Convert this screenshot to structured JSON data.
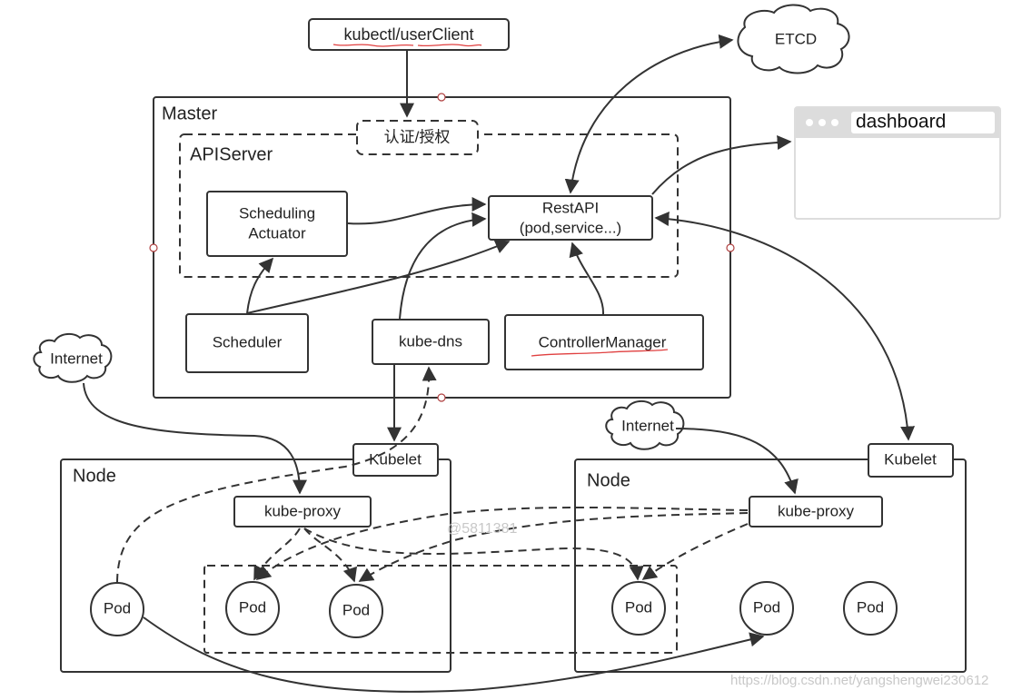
{
  "diagram": {
    "client": {
      "label": "kubectl/userClient"
    },
    "etcd": {
      "label": "ETCD"
    },
    "dashboard": {
      "label": "dashboard"
    },
    "master": {
      "title": "Master",
      "auth": {
        "label": "认证/授权"
      },
      "apiserver": {
        "title": "APIServer",
        "scheduling_actuator": {
          "line1": "Scheduling",
          "line2": "Actuator"
        },
        "restapi": {
          "line1": "RestAPI",
          "line2": "(pod,service...)"
        }
      },
      "scheduler": {
        "label": "Scheduler"
      },
      "kube_dns": {
        "label": "kube-dns"
      },
      "controller_manager": {
        "label": "ControllerManager"
      }
    },
    "internet_left": {
      "label": "Internet"
    },
    "internet_right": {
      "label": "Internet"
    },
    "node_left": {
      "title": "Node",
      "kubelet": {
        "label": "Kubelet"
      },
      "kube_proxy": {
        "label": "kube-proxy"
      },
      "pods": [
        "Pod",
        "Pod",
        "Pod"
      ]
    },
    "node_right": {
      "title": "Node",
      "kubelet": {
        "label": "Kubelet"
      },
      "kube_proxy": {
        "label": "kube-proxy"
      },
      "pods": [
        "Pod",
        "Pod",
        "Pod"
      ]
    },
    "watermarks": {
      "center": "@5811381",
      "footer": "https://blog.csdn.net/yangshengwei230612"
    }
  }
}
